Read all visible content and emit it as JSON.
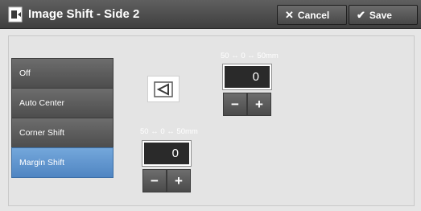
{
  "header": {
    "title": "Image Shift - Side 2",
    "title_icon": "image-shift-icon",
    "cancel": {
      "label": "Cancel",
      "icon": "close-icon"
    },
    "save": {
      "label": "Save",
      "icon": "checkmark-icon"
    }
  },
  "options": [
    {
      "label": "Off",
      "selected": false
    },
    {
      "label": "Auto Center",
      "selected": false
    },
    {
      "label": "Corner Shift",
      "selected": false
    },
    {
      "label": "Margin Shift",
      "selected": true
    }
  ],
  "direction_icon": "side-edge-direction-icon",
  "vertical": {
    "range": "50 ↔ 0 ↔ 50mm",
    "value": "0",
    "minus": "−",
    "plus": "+"
  },
  "horizontal": {
    "range": "50 ↔ 0 ↔ 50mm",
    "value": "0",
    "minus": "−",
    "plus": "+"
  },
  "colors": {
    "header": "#4a4a4a",
    "selected": "#5b93cf",
    "background": "#e4e4e4"
  }
}
